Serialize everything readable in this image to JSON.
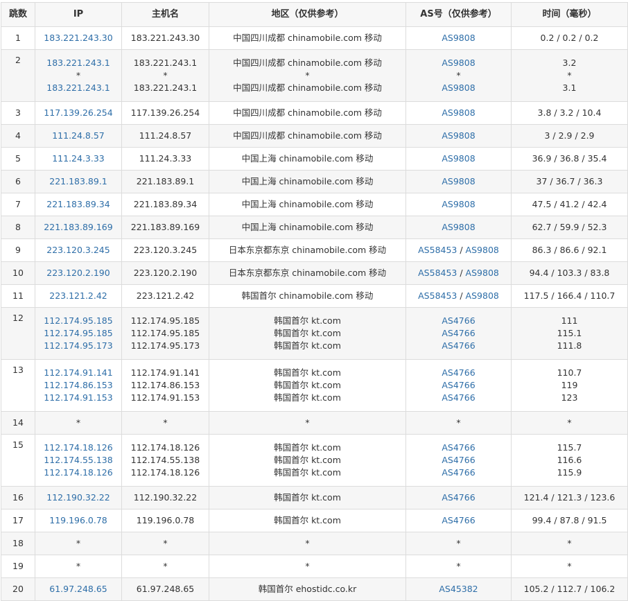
{
  "headers": {
    "hop": "跳数",
    "ip": "IP",
    "host": "主机名",
    "region": "地区（仅供参考）",
    "as": "AS号（仅供参考）",
    "time": "时间（毫秒）"
  },
  "rows": [
    {
      "hop": "1",
      "ips": [
        "183.221.243.30"
      ],
      "hosts": [
        "183.221.243.30"
      ],
      "regions": [
        "中国四川成都 chinamobile.com 移动"
      ],
      "as": [
        [
          "AS9808"
        ]
      ],
      "times": [
        "0.2 / 0.2 / 0.2"
      ]
    },
    {
      "hop": "2",
      "ips": [
        "183.221.243.1",
        "*",
        "183.221.243.1"
      ],
      "hosts": [
        "183.221.243.1",
        "*",
        "183.221.243.1"
      ],
      "regions": [
        "中国四川成都 chinamobile.com 移动",
        "*",
        "中国四川成都 chinamobile.com 移动"
      ],
      "as": [
        [
          "AS9808"
        ],
        [
          "*"
        ],
        [
          "AS9808"
        ]
      ],
      "times": [
        "3.2",
        "*",
        "3.1"
      ]
    },
    {
      "hop": "3",
      "ips": [
        "117.139.26.254"
      ],
      "hosts": [
        "117.139.26.254"
      ],
      "regions": [
        "中国四川成都 chinamobile.com 移动"
      ],
      "as": [
        [
          "AS9808"
        ]
      ],
      "times": [
        "3.8 / 3.2 / 10.4"
      ]
    },
    {
      "hop": "4",
      "ips": [
        "111.24.8.57"
      ],
      "hosts": [
        "111.24.8.57"
      ],
      "regions": [
        "中国四川成都 chinamobile.com 移动"
      ],
      "as": [
        [
          "AS9808"
        ]
      ],
      "times": [
        "3 / 2.9 / 2.9"
      ]
    },
    {
      "hop": "5",
      "ips": [
        "111.24.3.33"
      ],
      "hosts": [
        "111.24.3.33"
      ],
      "regions": [
        "中国上海 chinamobile.com 移动"
      ],
      "as": [
        [
          "AS9808"
        ]
      ],
      "times": [
        "36.9 / 36.8 / 35.4"
      ]
    },
    {
      "hop": "6",
      "ips": [
        "221.183.89.1"
      ],
      "hosts": [
        "221.183.89.1"
      ],
      "regions": [
        "中国上海 chinamobile.com 移动"
      ],
      "as": [
        [
          "AS9808"
        ]
      ],
      "times": [
        "37 / 36.7 / 36.3"
      ]
    },
    {
      "hop": "7",
      "ips": [
        "221.183.89.34"
      ],
      "hosts": [
        "221.183.89.34"
      ],
      "regions": [
        "中国上海 chinamobile.com 移动"
      ],
      "as": [
        [
          "AS9808"
        ]
      ],
      "times": [
        "47.5 / 41.2 / 42.4"
      ]
    },
    {
      "hop": "8",
      "ips": [
        "221.183.89.169"
      ],
      "hosts": [
        "221.183.89.169"
      ],
      "regions": [
        "中国上海 chinamobile.com 移动"
      ],
      "as": [
        [
          "AS9808"
        ]
      ],
      "times": [
        "62.7 / 59.9 / 52.3"
      ]
    },
    {
      "hop": "9",
      "ips": [
        "223.120.3.245"
      ],
      "hosts": [
        "223.120.3.245"
      ],
      "regions": [
        "日本东京都东京 chinamobile.com 移动"
      ],
      "as": [
        [
          "AS58453",
          "AS9808"
        ]
      ],
      "times": [
        "86.3 / 86.6 / 92.1"
      ]
    },
    {
      "hop": "10",
      "ips": [
        "223.120.2.190"
      ],
      "hosts": [
        "223.120.2.190"
      ],
      "regions": [
        "日本东京都东京 chinamobile.com 移动"
      ],
      "as": [
        [
          "AS58453",
          "AS9808"
        ]
      ],
      "times": [
        "94.4 / 103.3 / 83.8"
      ]
    },
    {
      "hop": "11",
      "ips": [
        "223.121.2.42"
      ],
      "hosts": [
        "223.121.2.42"
      ],
      "regions": [
        "韩国首尔 chinamobile.com 移动"
      ],
      "as": [
        [
          "AS58453",
          "AS9808"
        ]
      ],
      "times": [
        "117.5 / 166.4 / 110.7"
      ]
    },
    {
      "hop": "12",
      "ips": [
        "112.174.95.185",
        "112.174.95.185",
        "112.174.95.173"
      ],
      "hosts": [
        "112.174.95.185",
        "112.174.95.185",
        "112.174.95.173"
      ],
      "regions": [
        "韩国首尔 kt.com",
        "韩国首尔 kt.com",
        "韩国首尔 kt.com"
      ],
      "as": [
        [
          "AS4766"
        ],
        [
          "AS4766"
        ],
        [
          "AS4766"
        ]
      ],
      "times": [
        "111",
        "115.1",
        "111.8"
      ]
    },
    {
      "hop": "13",
      "ips": [
        "112.174.91.141",
        "112.174.86.153",
        "112.174.91.153"
      ],
      "hosts": [
        "112.174.91.141",
        "112.174.86.153",
        "112.174.91.153"
      ],
      "regions": [
        "韩国首尔 kt.com",
        "韩国首尔 kt.com",
        "韩国首尔 kt.com"
      ],
      "as": [
        [
          "AS4766"
        ],
        [
          "AS4766"
        ],
        [
          "AS4766"
        ]
      ],
      "times": [
        "110.7",
        "119",
        "123"
      ]
    },
    {
      "hop": "14",
      "ips": [
        "*"
      ],
      "hosts": [
        "*"
      ],
      "regions": [
        "*"
      ],
      "as": [
        [
          "*"
        ]
      ],
      "times": [
        "*"
      ]
    },
    {
      "hop": "15",
      "ips": [
        "112.174.18.126",
        "112.174.55.138",
        "112.174.18.126"
      ],
      "hosts": [
        "112.174.18.126",
        "112.174.55.138",
        "112.174.18.126"
      ],
      "regions": [
        "韩国首尔 kt.com",
        "韩国首尔 kt.com",
        "韩国首尔 kt.com"
      ],
      "as": [
        [
          "AS4766"
        ],
        [
          "AS4766"
        ],
        [
          "AS4766"
        ]
      ],
      "times": [
        "115.7",
        "116.6",
        "115.9"
      ]
    },
    {
      "hop": "16",
      "ips": [
        "112.190.32.22"
      ],
      "hosts": [
        "112.190.32.22"
      ],
      "regions": [
        "韩国首尔 kt.com"
      ],
      "as": [
        [
          "AS4766"
        ]
      ],
      "times": [
        "121.4 / 121.3 / 123.6"
      ]
    },
    {
      "hop": "17",
      "ips": [
        "119.196.0.78"
      ],
      "hosts": [
        "119.196.0.78"
      ],
      "regions": [
        "韩国首尔 kt.com"
      ],
      "as": [
        [
          "AS4766"
        ]
      ],
      "times": [
        "99.4 / 87.8 / 91.5"
      ]
    },
    {
      "hop": "18",
      "ips": [
        "*"
      ],
      "hosts": [
        "*"
      ],
      "regions": [
        "*"
      ],
      "as": [
        [
          "*"
        ]
      ],
      "times": [
        "*"
      ]
    },
    {
      "hop": "19",
      "ips": [
        "*"
      ],
      "hosts": [
        "*"
      ],
      "regions": [
        "*"
      ],
      "as": [
        [
          "*"
        ]
      ],
      "times": [
        "*"
      ]
    },
    {
      "hop": "20",
      "ips": [
        "61.97.248.65"
      ],
      "hosts": [
        "61.97.248.65"
      ],
      "regions": [
        "韩国首尔 ehostidc.co.kr"
      ],
      "as": [
        [
          "AS45382"
        ]
      ],
      "times": [
        "105.2 / 112.7 / 106.2"
      ]
    }
  ]
}
